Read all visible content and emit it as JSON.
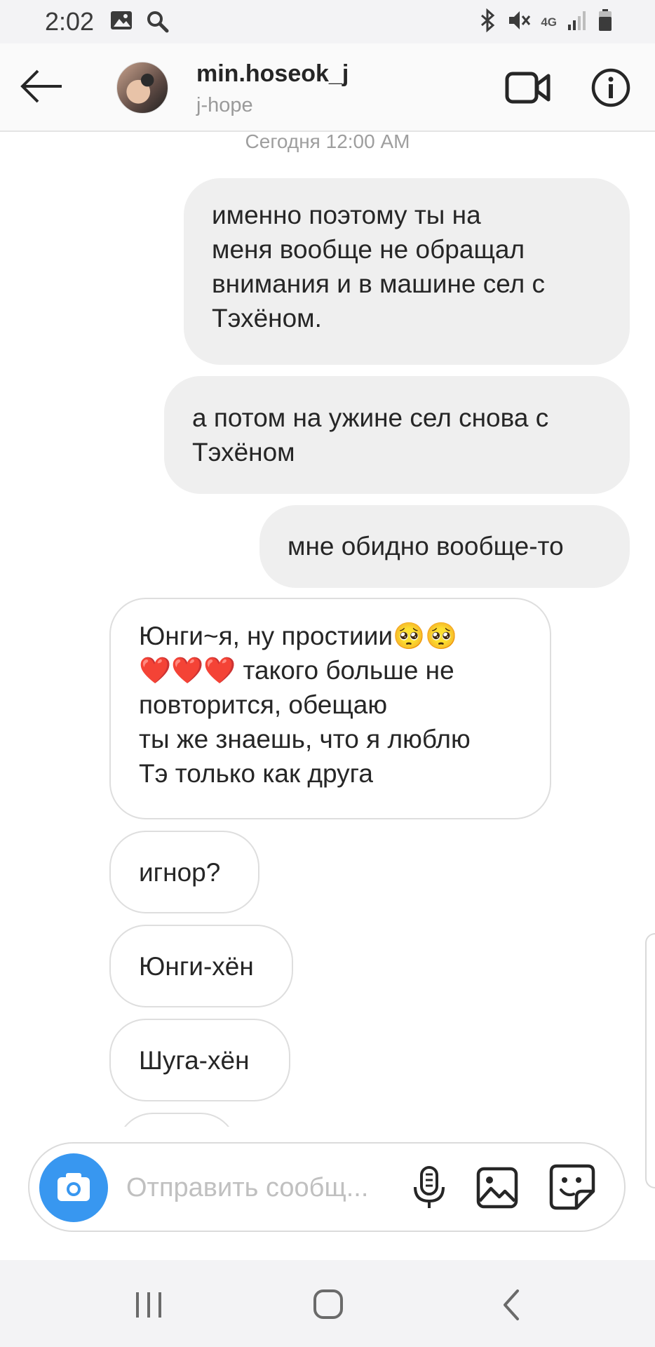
{
  "status_bar": {
    "time": "2:02",
    "network": "4G",
    "icons": [
      "image-icon",
      "search-icon",
      "bluetooth-icon",
      "mute-icon",
      "signal-icon",
      "battery-icon"
    ]
  },
  "header": {
    "username": "min.hoseok_j",
    "subname": "j-hope",
    "icons": [
      "back-arrow-icon",
      "avatar",
      "video-call-icon",
      "info-icon"
    ]
  },
  "chat": {
    "timestamp": "Сегодня 12:00 AM",
    "messages": [
      {
        "direction": "out",
        "lines": [
          "именно поэтому ты на",
          "меня вообще не обращал",
          "внимания и в машине сел с",
          "Тэхёном."
        ]
      },
      {
        "direction": "out",
        "lines": [
          "а потом на ужине сел снова с",
          "Тэхёном"
        ]
      },
      {
        "direction": "out",
        "lines": [
          "мне обидно вообще-то"
        ]
      },
      {
        "direction": "in",
        "lines": [
          "Юнги~я, ну простиии🥺🥺",
          "❤️❤️❤️ такого больше не",
          "повторится, обещаю",
          "ты же знаешь, что я люблю",
          "Тэ только как друга"
        ]
      },
      {
        "direction": "in",
        "lines": [
          "игнор?"
        ]
      },
      {
        "direction": "in",
        "lines": [
          "Юнги-хён"
        ]
      },
      {
        "direction": "in",
        "lines": [
          "Шуга-хён"
        ]
      }
    ]
  },
  "composer": {
    "placeholder": "Отправить сообщ...",
    "icons": [
      "camera-icon",
      "microphone-icon",
      "gallery-icon",
      "sticker-icon"
    ]
  },
  "nav_bar": {
    "icons": [
      "recent-apps-icon",
      "home-icon",
      "back-icon"
    ]
  },
  "colors": {
    "accent": "#3897f0",
    "outgoing_bubble": "#efefef",
    "incoming_border": "#dedede",
    "bar_background": "#f3f3f5"
  }
}
